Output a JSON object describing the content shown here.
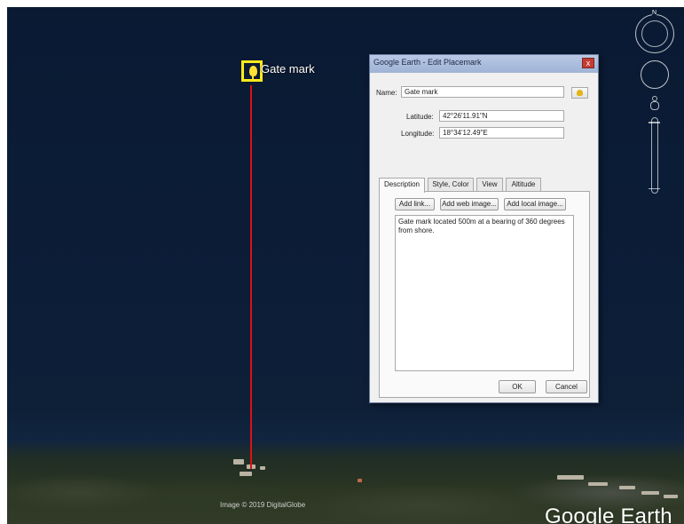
{
  "map": {
    "placemark_label": "Gate mark",
    "credit": "Image © 2019 DigitalGlobe",
    "brand": "Google Earth",
    "pin_color": "#ffeb1a",
    "line_color": "#dd1111"
  },
  "nav": {
    "compass_label": "N",
    "icons": [
      "compass-icon",
      "look-joystick-icon",
      "street-view-person-icon",
      "zoom-slider"
    ]
  },
  "dialog": {
    "title": "Google Earth - Edit Placemark",
    "close_label": "x",
    "name_label": "Name:",
    "name_value": "Gate mark",
    "latitude_label": "Latitude:",
    "latitude_value": "42°26'11.91\"N",
    "longitude_label": "Longitude:",
    "longitude_value": "18°34'12.49\"E",
    "tabs": [
      {
        "label": "Description",
        "active": true
      },
      {
        "label": "Style, Color",
        "active": false
      },
      {
        "label": "View",
        "active": false
      },
      {
        "label": "Altitude",
        "active": false
      }
    ],
    "add_link_label": "Add link...",
    "add_web_image_label": "Add web image...",
    "add_local_image_label": "Add local image...",
    "description": "Gate mark located 500m at a bearing of 360 degrees from shore.",
    "ok_label": "OK",
    "cancel_label": "Cancel"
  }
}
